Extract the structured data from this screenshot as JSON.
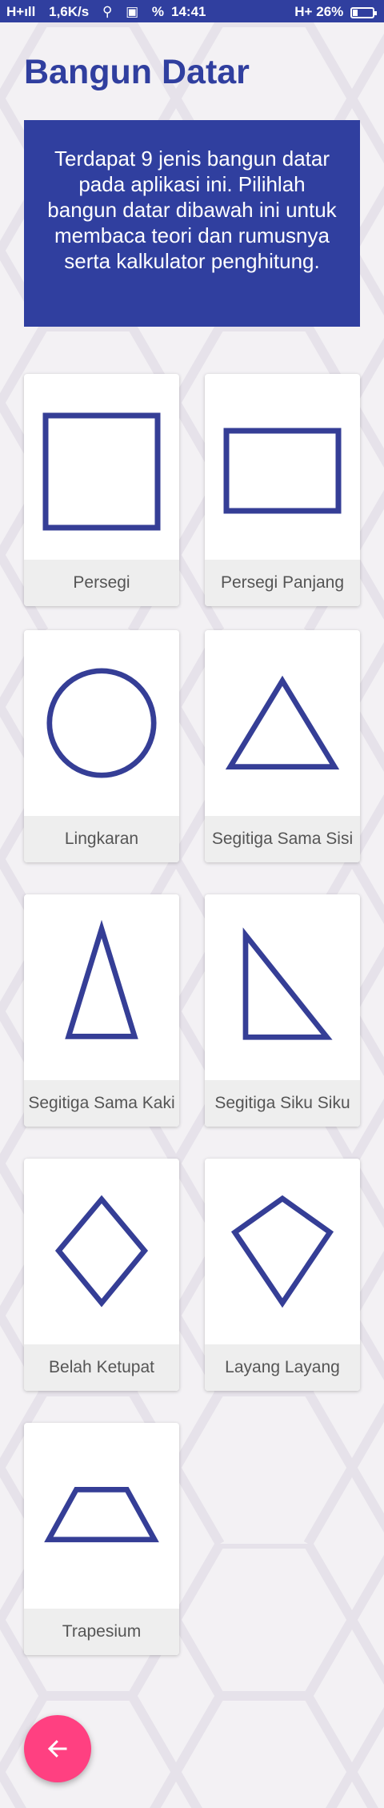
{
  "status_bar": {
    "network": "H+ıll",
    "speed": "1,6K/s",
    "time": "14:41",
    "signal": "H+",
    "battery": "26%",
    "battery_level": 0.26
  },
  "page": {
    "title": "Bangun Datar",
    "intro": "Terdapat 9 jenis bangun datar pada aplikasi ini. Pilihlah bangun datar dibawah ini untuk membaca teori dan rumusnya serta kalkulator penghitung."
  },
  "shapes": [
    {
      "label": "Persegi",
      "icon": "square-icon"
    },
    {
      "label": "Persegi Panjang",
      "icon": "rectangle-icon"
    },
    {
      "label": "Lingkaran",
      "icon": "circle-icon"
    },
    {
      "label": "Segitiga Sama Sisi",
      "icon": "equilateral-triangle-icon"
    },
    {
      "label": "Segitiga Sama Kaki",
      "icon": "isosceles-triangle-icon"
    },
    {
      "label": "Segitiga Siku Siku",
      "icon": "right-triangle-icon"
    },
    {
      "label": "Belah Ketupat",
      "icon": "rhombus-icon"
    },
    {
      "label": "Layang Layang",
      "icon": "kite-icon"
    },
    {
      "label": "Trapesium",
      "icon": "trapezoid-icon"
    }
  ],
  "fab": {
    "icon": "arrow-left-icon"
  },
  "colors": {
    "primary": "#303f9f",
    "accent": "#ff4081",
    "shape_stroke": "#353e96",
    "card_label_bg": "#eeeeee"
  }
}
